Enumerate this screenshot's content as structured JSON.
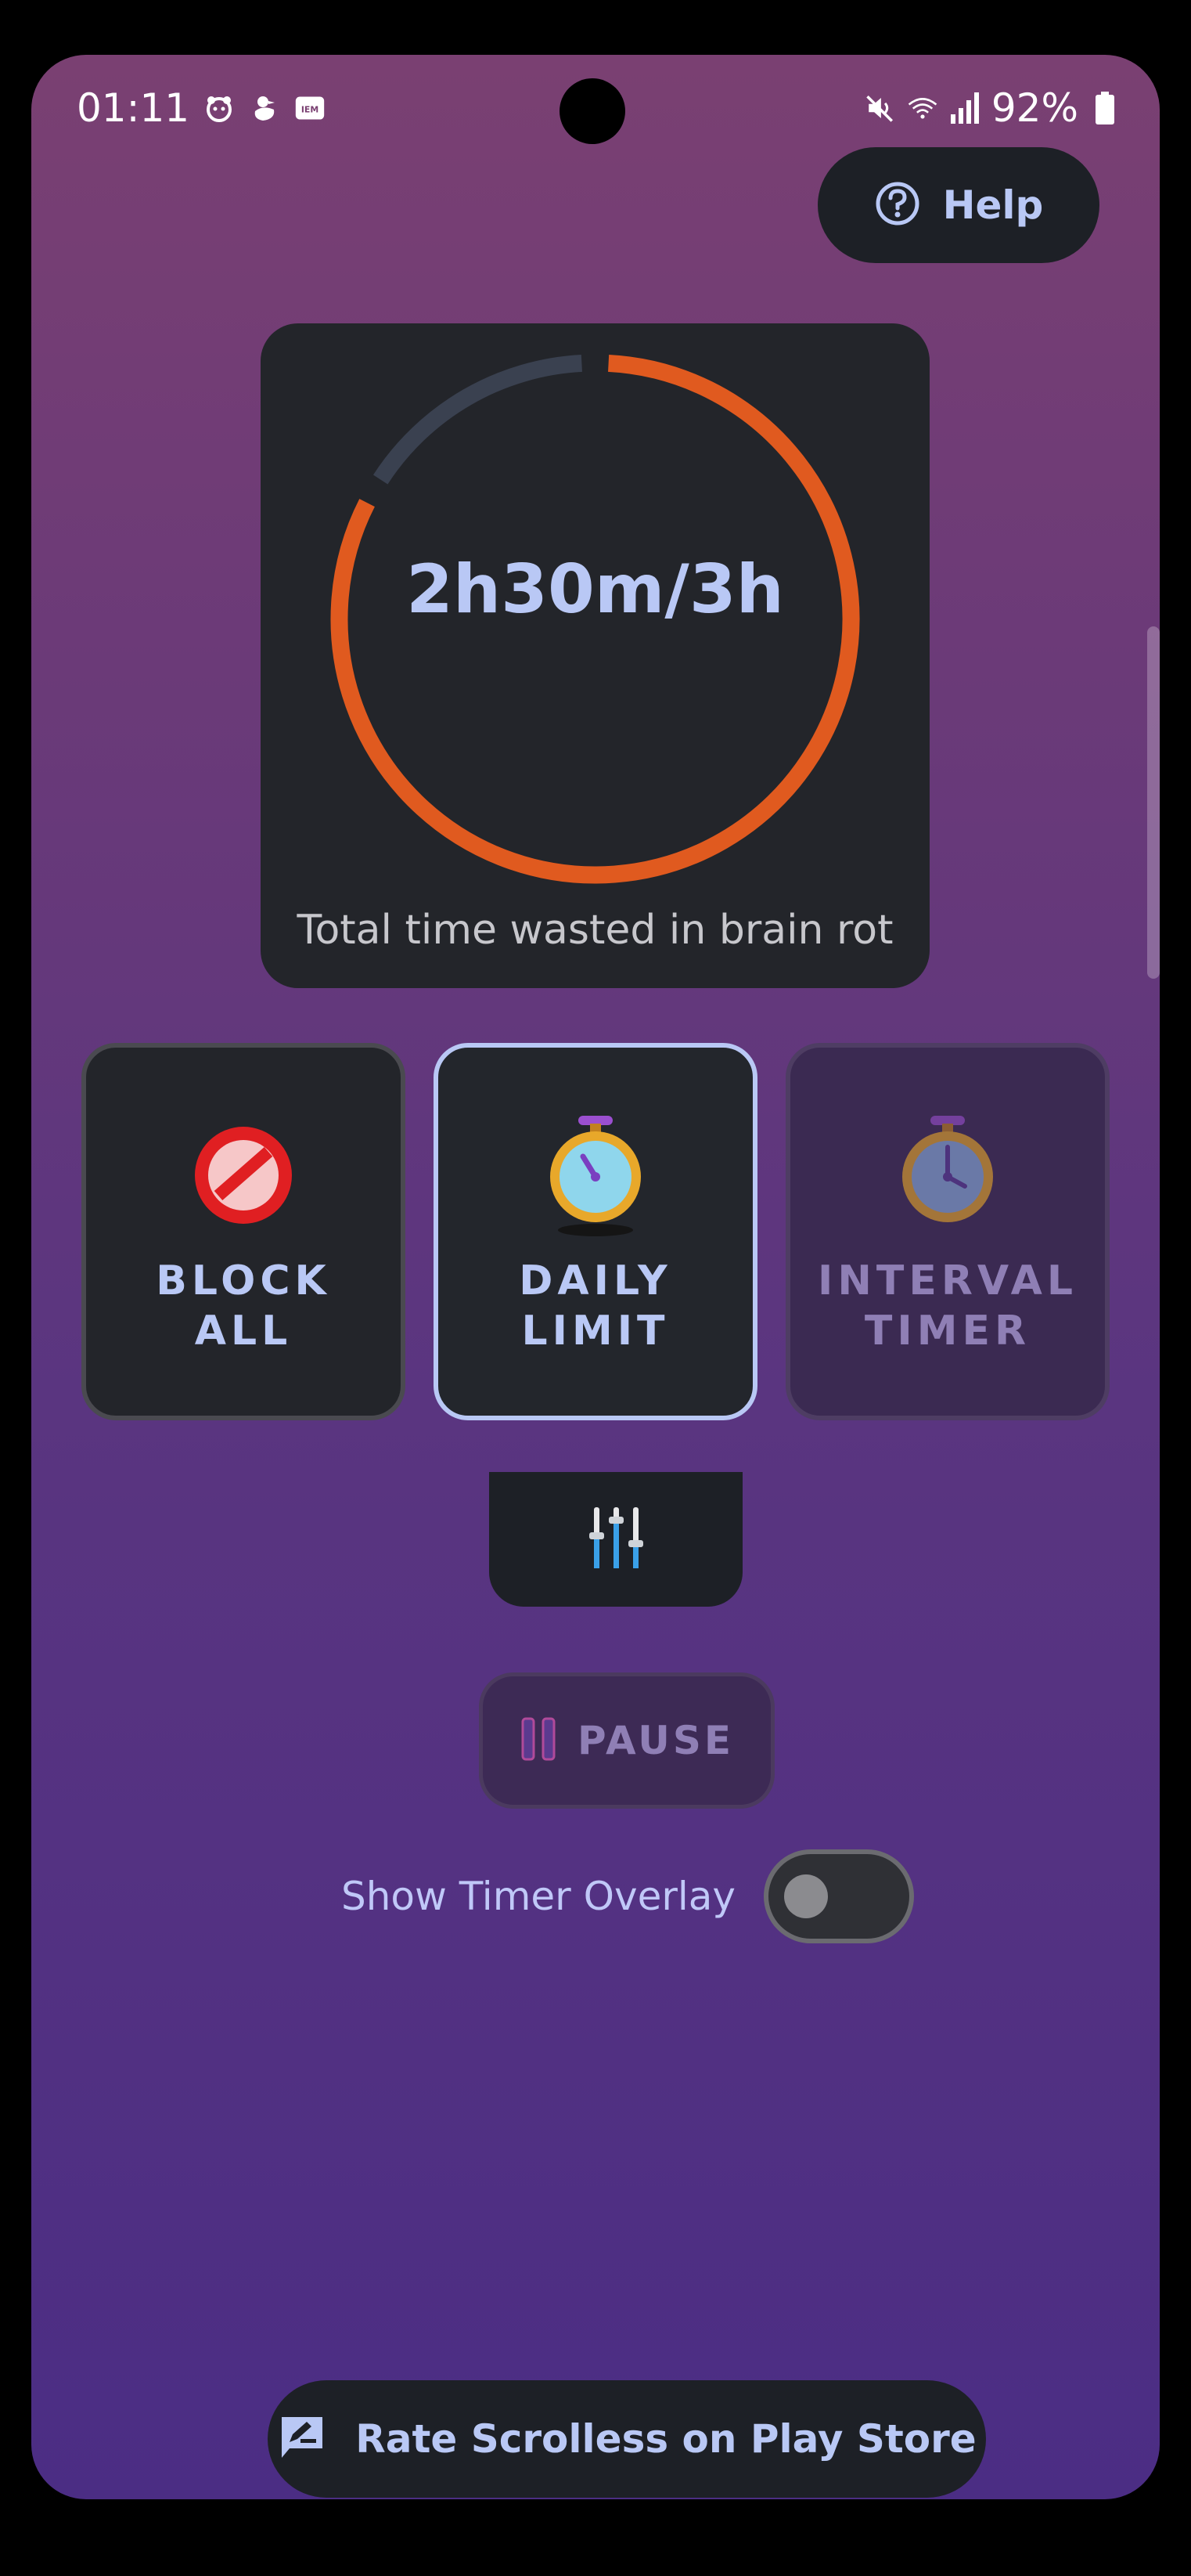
{
  "status_bar": {
    "time": "01:11",
    "left_icons": [
      "bear-face-icon",
      "duck-icon",
      "iem-badge-icon"
    ],
    "iem_badge": "IEM",
    "right_icons": [
      "mute-icon",
      "wifi-icon",
      "signal-icon",
      "battery-icon"
    ],
    "battery": "92%"
  },
  "help": {
    "label": "Help",
    "icon": "help-circle-icon"
  },
  "usage_gauge": {
    "value_text": "2h30m/3h",
    "caption": "Total time wasted in brain rot",
    "progress": 0.8333,
    "colors": {
      "used": "#e05a1f",
      "remaining": "#3a4150"
    }
  },
  "modes": [
    {
      "id": "block-all",
      "label": "BLOCK\nALL",
      "icon": "no-entry-icon",
      "state": "normal"
    },
    {
      "id": "daily-limit",
      "label": "DAILY\nLIMIT",
      "icon": "stopwatch-icon",
      "state": "selected"
    },
    {
      "id": "interval-timer",
      "label": "INTERVAL\nTIMER",
      "icon": "stopwatch-icon",
      "state": "disabled"
    }
  ],
  "settings": {
    "icon": "sliders-icon"
  },
  "pause": {
    "label": "PAUSE",
    "icon": "pause-icon"
  },
  "overlay": {
    "label": "Show Timer Overlay",
    "enabled": false
  },
  "rate": {
    "label": "Rate Scrolless on Play Store",
    "icon": "rate-review-icon"
  },
  "colors": {
    "accent": "#b9c8f5",
    "card": "#23252a",
    "gauge_orange": "#e05a1f"
  }
}
